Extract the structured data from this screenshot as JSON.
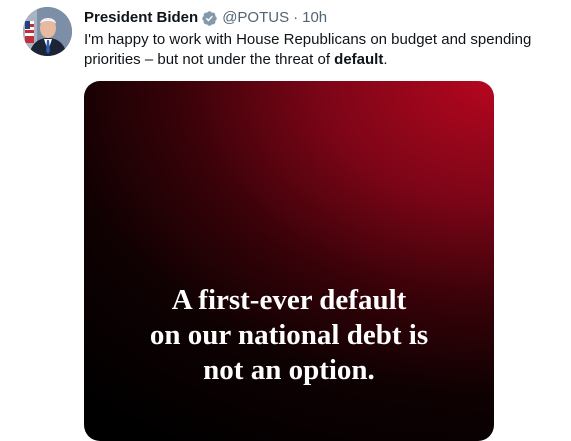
{
  "tweet": {
    "author": {
      "display_name": "President Biden",
      "handle": "@POTUS",
      "verified": true,
      "avatar_icon": "avatar-photo"
    },
    "separator": "·",
    "timestamp": "10h",
    "text_before": "I'm happy to work with House Republicans on budget and spending priorities – but not under the threat of ",
    "text_bold": "default",
    "text_after": ".",
    "media": {
      "lines": [
        "A first-ever default",
        "on our national debt is",
        "not an option."
      ]
    }
  },
  "colors": {
    "text_primary": "#0f1419",
    "text_secondary": "#536471",
    "verified_badge": "#829aab",
    "media_accent": "#b5071f"
  }
}
